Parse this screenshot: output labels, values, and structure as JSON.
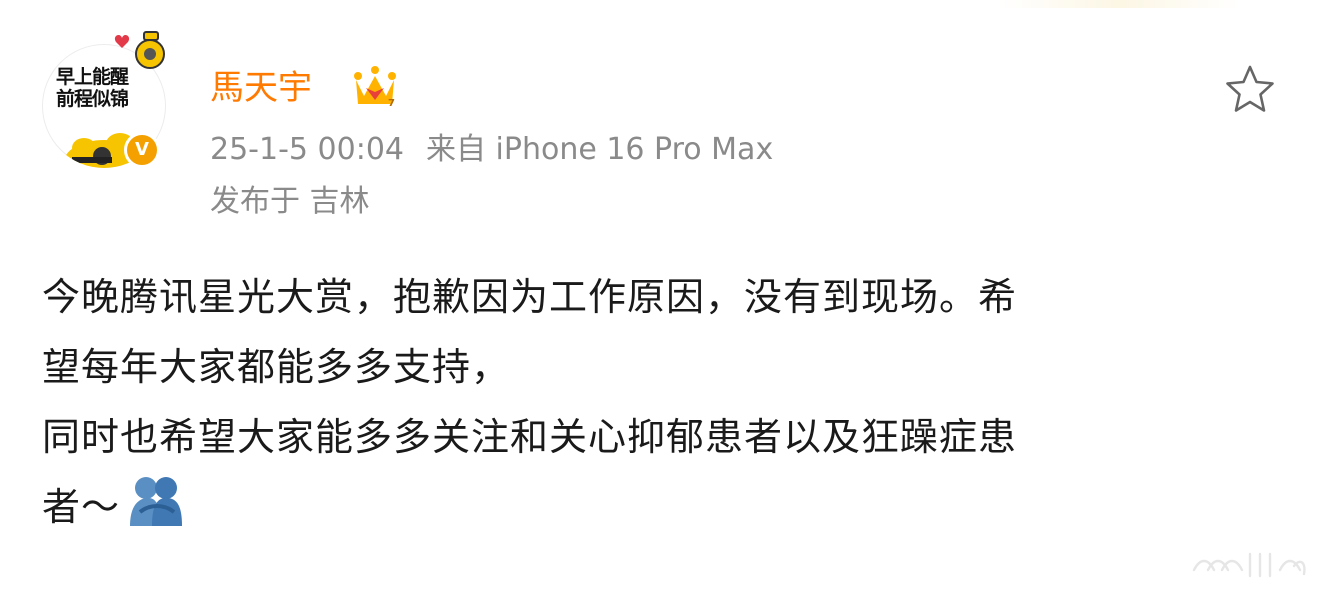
{
  "post": {
    "author": {
      "name": "馬天宇",
      "avatar_text": "早上能醒\n前程似锦",
      "verified_icon": "verified-v-badge",
      "member_icon": "crown-icon"
    },
    "time": "25-1-5 00:04",
    "source": "来自 iPhone 16 Pro Max",
    "location": "发布于 吉林",
    "content": {
      "line1": "今晚腾讯星光大赏，抱歉因为工作原因，没有到现场。希",
      "line2": "望每年大家都能多多支持，",
      "line3": "同时也希望大家能多多关注和关心抑郁患者以及狂躁症患",
      "line4": "者～",
      "emoji": "hug-emoji"
    },
    "favorite_icon": "star-icon"
  },
  "colors": {
    "username": "#ff7a00",
    "meta": "#8a8a8a",
    "text": "#1a1a1a",
    "verified": "#f4a000"
  }
}
